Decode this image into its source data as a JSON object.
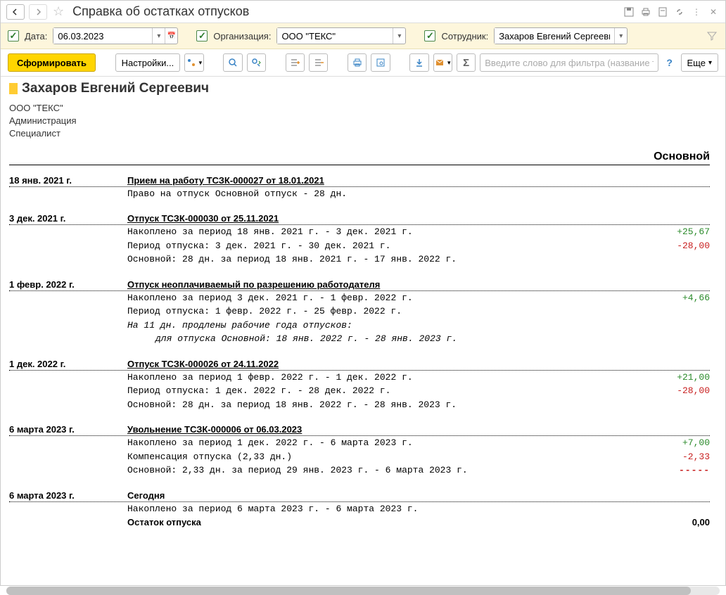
{
  "header": {
    "title": "Справка об остатках отпусков"
  },
  "filters": {
    "date_label": "Дата:",
    "date_value": "06.03.2023",
    "org_label": "Организация:",
    "org_value": "ООО \"ТЕКС\"",
    "emp_label": "Сотрудник:",
    "emp_value": "Захаров Евгений Сергеевич"
  },
  "toolbar": {
    "generate": "Сформировать",
    "settings": "Настройки...",
    "more": "Еще",
    "search_placeholder": "Введите слово для фильтра (название то..."
  },
  "report": {
    "employee": "Захаров Евгений Сергеевич",
    "org": "ООО \"ТЕКС\"",
    "dept": "Администрация",
    "position": "Специалист",
    "section_title": "Основной",
    "events": [
      {
        "date": "18 янв. 2021 г.",
        "title": "Прием на работу ТСЗК-000027 от 18.01.2021",
        "underline": true,
        "lines": [
          {
            "text": "Право на отпуск Основной отпуск - 28 дн."
          }
        ]
      },
      {
        "date": "3 дек. 2021 г.",
        "title": "Отпуск ТСЗК-000030 от 25.11.2021",
        "underline": true,
        "lines": [
          {
            "text": "Накоплено за период 18 янв. 2021 г. - 3 дек. 2021 г.",
            "amount": "+25,67",
            "cls": "pos"
          },
          {
            "text": "Период отпуска: 3 дек. 2021 г. - 30 дек. 2021 г.",
            "amount": "-28,00",
            "cls": "neg"
          },
          {
            "text": "Основной: 28 дн. за период 18 янв. 2021 г. - 17 янв. 2022 г."
          }
        ]
      },
      {
        "date": "1 февр. 2022 г.",
        "title": "Отпуск неоплачиваемый по разрешению работодателя",
        "underline": true,
        "lines": [
          {
            "text": "Накоплено за период 3 дек. 2021 г. - 1 февр. 2022 г.",
            "amount": "+4,66",
            "cls": "pos"
          },
          {
            "text": "Период отпуска: 1 февр. 2022 г. - 25 февр. 2022 г."
          },
          {
            "text": "На 11 дн. продлены рабочие года отпусков:",
            "italic": true
          },
          {
            "text": "для отпуска Основной: 18 янв. 2022 г. - 28 янв. 2023 г.",
            "italic": true,
            "indent": true
          }
        ]
      },
      {
        "date": "1 дек. 2022 г.",
        "title": "Отпуск ТСЗК-000026 от 24.11.2022",
        "underline": true,
        "lines": [
          {
            "text": "Накоплено за период 1 февр. 2022 г. - 1 дек. 2022 г.",
            "amount": "+21,00",
            "cls": "pos"
          },
          {
            "text": "Период отпуска: 1 дек. 2022 г. - 28 дек. 2022 г.",
            "amount": "-28,00",
            "cls": "neg"
          },
          {
            "text": "Основной: 28 дн. за период 18 янв. 2022 г. - 28 янв. 2023 г."
          }
        ]
      },
      {
        "date": "6 марта 2023 г.",
        "title": "Увольнение ТСЗК-000006 от 06.03.2023",
        "underline": true,
        "lines": [
          {
            "text": "Накоплено за период 1 дек. 2022 г. - 6 марта 2023 г.",
            "amount": "+7,00",
            "cls": "pos"
          },
          {
            "text": "Компенсация отпуска (2,33 дн.)",
            "amount": "-2,33",
            "cls": "neg"
          },
          {
            "text": "Основной: 2,33 дн. за период 29 янв. 2023 г. - 6 марта 2023 г.",
            "amount": "-----",
            "cls": "dashes"
          }
        ]
      }
    ],
    "today": {
      "date": "6 марта 2023 г.",
      "title": "Сегодня",
      "line": "Накоплено за период 6 марта 2023 г. - 6 марта 2023 г.",
      "balance_label": "Остаток отпуска",
      "balance_value": "0,00"
    }
  }
}
